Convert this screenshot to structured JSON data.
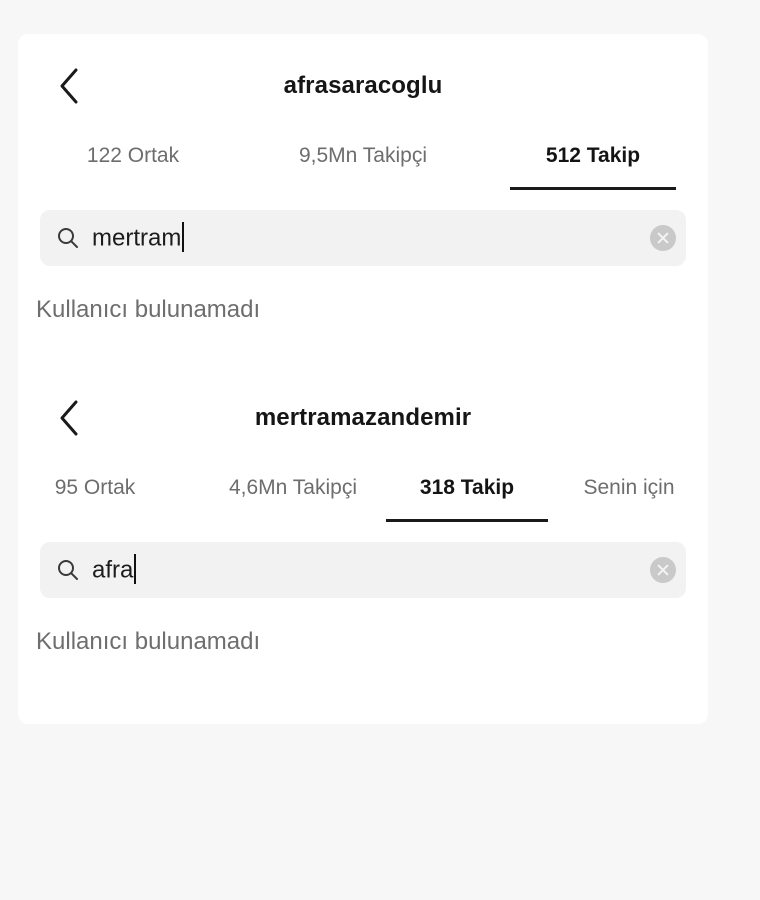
{
  "panels": [
    {
      "title": "afrasaracoglu",
      "tabs": [
        {
          "label": "122 Ortak",
          "active": false
        },
        {
          "label": "9,5Mn Takipçi",
          "active": false
        },
        {
          "label": "512 Takip",
          "active": true
        }
      ],
      "search_value": "mertram",
      "empty_message": "Kullanıcı bulunamadı"
    },
    {
      "title": "mertramazandemir",
      "tabs": [
        {
          "label": "95 Ortak",
          "active": false
        },
        {
          "label": "4,6Mn Takipçi",
          "active": false
        },
        {
          "label": "318 Takip",
          "active": true
        },
        {
          "label": "Senin için",
          "active": false
        }
      ],
      "search_value": "afra",
      "empty_message": "Kullanıcı bulunamadı"
    }
  ],
  "icons": {
    "back": "chevron-left-icon",
    "search": "search-icon",
    "clear": "clear-icon"
  },
  "colors": {
    "active_tab": "#141414",
    "inactive_tab": "#6d6d6d",
    "search_bg": "#f2f2f2",
    "empty_message": "#6e6e6e"
  }
}
